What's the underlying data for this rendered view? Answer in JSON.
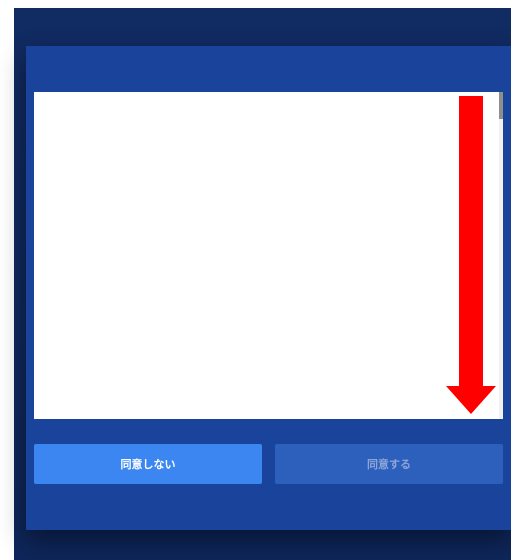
{
  "dialog": {
    "content": "",
    "scroll_position": 0,
    "annotation": {
      "shape": "down-arrow-icon",
      "color": "#ff0000"
    }
  },
  "buttons": {
    "disagree_label": "同意しない",
    "agree_label": "同意する",
    "agree_disabled": true
  },
  "colors": {
    "backdrop": "#112b63",
    "dialog": "#1a449c",
    "primary_button": "#3c86f2",
    "disabled_button": "#2d5fbd",
    "disabled_text": "#8ba6d6"
  }
}
